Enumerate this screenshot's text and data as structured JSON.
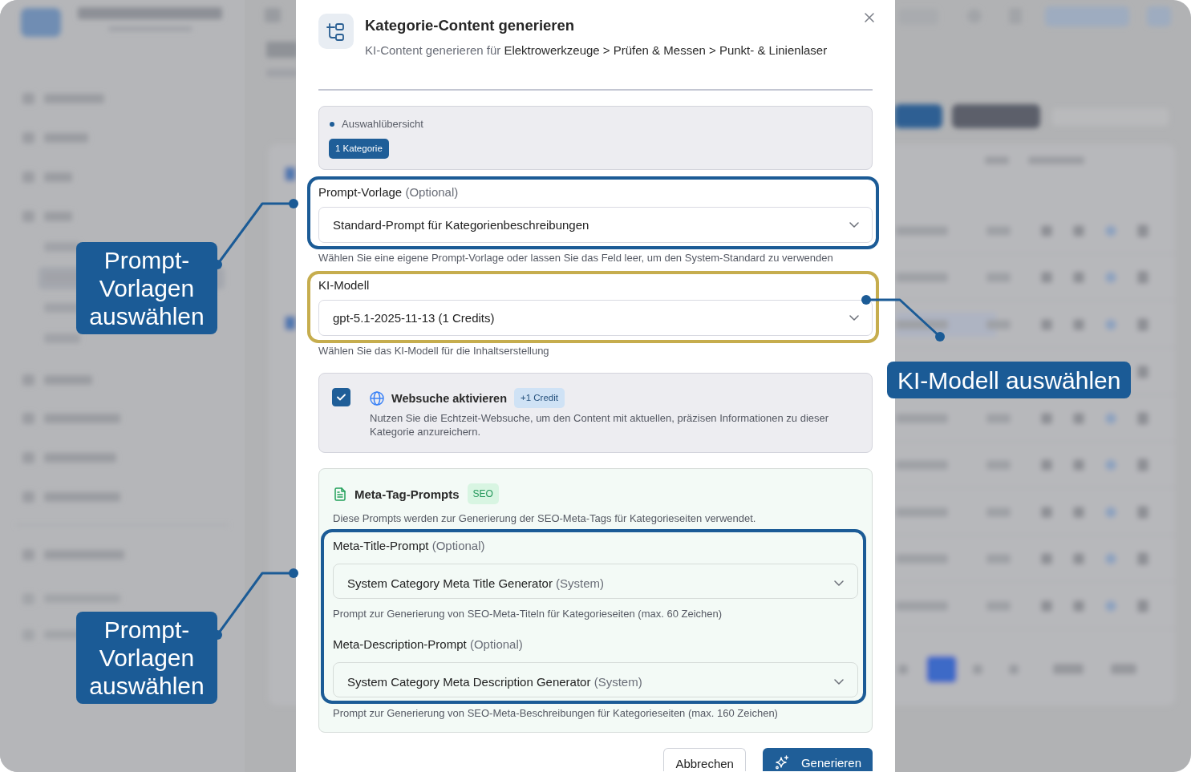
{
  "dialog": {
    "title": "Kategorie-Content generieren",
    "subtitle": "KI-Content generieren für",
    "breadcrumb": "Elektrowerkzeuge > Prüfen & Messen > Punkt- & Linienlaser",
    "summary": {
      "heading": "Auswahlübersicht",
      "badge": "1 Kategorie"
    },
    "fields": [
      {
        "label": "Prompt-Vorlage",
        "optional": "(Optional)",
        "value": "Standard-Prompt für Kategorienbeschreibungen",
        "help": "Wählen Sie eine eigene Prompt-Vorlage oder lassen Sie das Feld leer, um den System-Standard zu verwenden"
      },
      {
        "label": "KI-Modell",
        "value": "gpt-5.1-2025-11-13 (1 Credits)",
        "help": "Wählen Sie das KI-Modell für die Inhaltserstellung"
      }
    ],
    "web_search": {
      "checked": true,
      "title": "Websuche aktivieren",
      "badge": "+1 Credit",
      "description": "Nutzen Sie die Echtzeit-Websuche, um den Content mit aktuellen, präzisen Informationen zu dieser Kategorie anzureichern."
    },
    "meta_tags": {
      "title": "Meta-Tag-Prompts",
      "badge": "SEO",
      "description": "Diese Prompts werden zur Generierung der SEO-Meta-Tags für Kategorieseiten verwendet.",
      "fields": [
        {
          "label": "Meta-Title-Prompt",
          "optional": "(Optional)",
          "value": "System Category Meta Title Generator",
          "value_note": "(System)",
          "help": "Prompt zur Generierung von SEO-Meta-Titeln für Kategorieseiten (max. 60 Zeichen)"
        },
        {
          "label": "Meta-Description-Prompt",
          "optional": "(Optional)",
          "value": "System Category Meta Description Generator",
          "value_note": "(System)",
          "help": "Prompt zur Generierung von SEO-Meta-Beschreibungen für Kategorieseiten (max. 160 Zeichen)"
        }
      ]
    },
    "buttons": {
      "cancel": "Abbrechen",
      "submit": "Generieren"
    }
  },
  "callouts": [
    {
      "text": "Prompt-Vorlagen auswählen",
      "color": "#1b5b96"
    },
    {
      "text": "KI-Modell auswählen",
      "color": "#c6ad4e"
    },
    {
      "text": "Prompt-Vorlagen auswählen",
      "color": "#1b5b96"
    }
  ]
}
